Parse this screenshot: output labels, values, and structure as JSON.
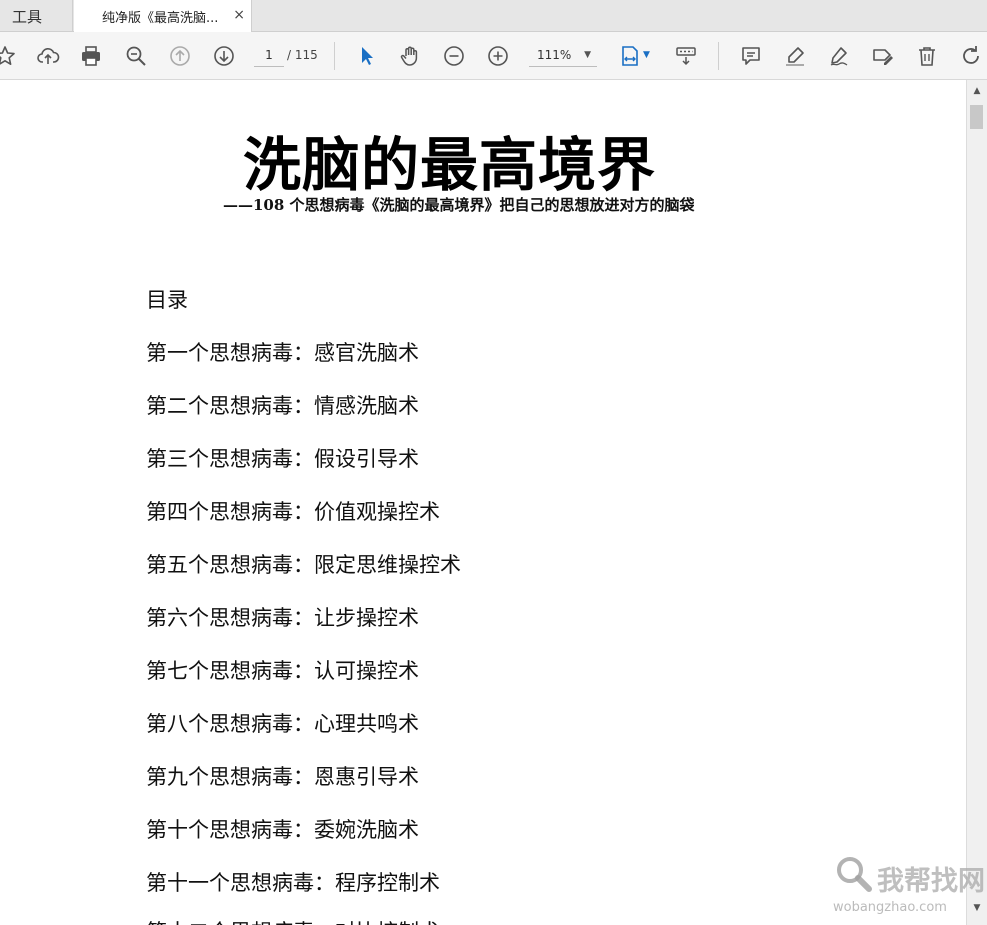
{
  "tabs": {
    "tools_label": "工具",
    "doc_tab_title": "纯净版《最高洗脑...",
    "close_glyph": "×"
  },
  "toolbar": {
    "page_current": "1",
    "page_total": "/ 115",
    "zoom_value": "111%",
    "zoom_caret": "▼",
    "icons": [
      "star-icon",
      "cloud-upload-icon",
      "print-icon",
      "zoom-out-magnifier-icon",
      "previous-page-icon",
      "next-page-icon",
      "select-cursor-icon",
      "hand-tool-icon",
      "zoom-out-icon",
      "zoom-in-icon",
      "fit-page-icon",
      "keyboard-scroll-icon",
      "comment-icon",
      "highlight-icon",
      "sign-icon",
      "edit-tag-icon",
      "delete-icon",
      "rotate-icon"
    ],
    "accent_color": "#1a6fc4"
  },
  "document": {
    "title": "洗脑的最高境界",
    "subtitle": "——108 个思想病毒《洗脑的最高境界》把自己的思想放进对方的脑袋",
    "toc_heading": "目录",
    "toc_items": [
      "第一个思想病毒：感官洗脑术",
      "第二个思想病毒：情感洗脑术",
      "第三个思想病毒：假设引导术",
      "第四个思想病毒：价值观操控术",
      "第五个思想病毒：限定思维操控术",
      "第六个思想病毒：让步操控术",
      "第七个思想病毒：认可操控术",
      "第八个思想病毒：心理共鸣术",
      "第九个思想病毒：恩惠引导术",
      "第十个思想病毒：委婉洗脑术",
      "第十一个思想病毒：程序控制术",
      "第十二个思想病毒：对比控制术"
    ]
  },
  "scrollbar": {
    "up_glyph": "▲",
    "down_glyph": "▼"
  },
  "watermark": {
    "text": "我帮找网",
    "url": "wobangzhao.com"
  }
}
